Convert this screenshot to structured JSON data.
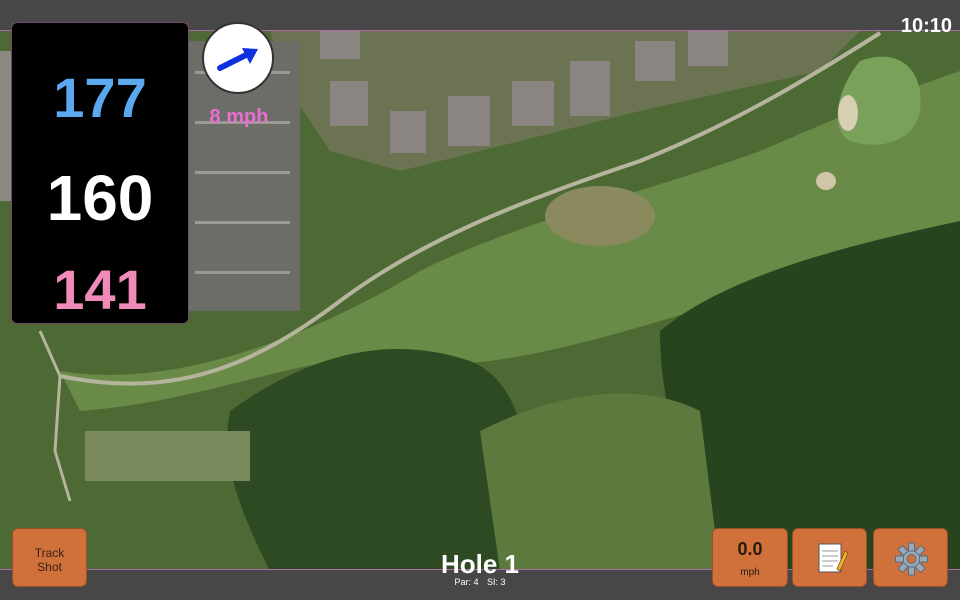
{
  "status": {
    "clock": "10:10"
  },
  "yardage": {
    "back": "177",
    "middle": "160",
    "front": "141"
  },
  "wind": {
    "speed_label": "8 mph",
    "direction": "east-northeast"
  },
  "hole": {
    "title": "Hole 1",
    "par_label": "Par: 4",
    "si_label": "SI: 3"
  },
  "buttons": {
    "track_line1": "Track",
    "track_line2": "Shot",
    "speed_value": "0.0",
    "speed_unit": "mph",
    "notes_icon": "notepad-icon",
    "settings_icon": "gear-icon"
  },
  "colors": {
    "back": "#5ba8ee",
    "middle": "#ffffff",
    "front": "#f08ab8",
    "accent_button": "#d0713c",
    "wind_label": "#e86fd0"
  }
}
